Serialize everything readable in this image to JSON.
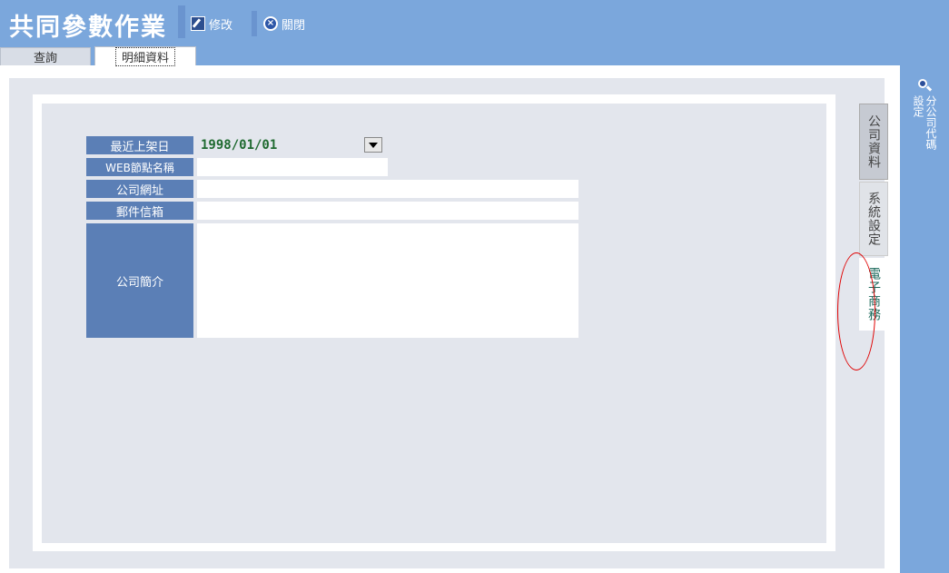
{
  "header": {
    "title": "共同參數作業",
    "edit_label": "修改",
    "close_label": "關閉"
  },
  "top_tabs": [
    {
      "label": "查詢"
    },
    {
      "label": "明細資料"
    }
  ],
  "form": {
    "fields": [
      {
        "label": "最近上架日",
        "value": "1998/01/01"
      },
      {
        "label": "WEB節點名稱",
        "value": ""
      },
      {
        "label": "公司網址",
        "value": ""
      },
      {
        "label": "郵件信箱",
        "value": ""
      },
      {
        "label": "公司簡介",
        "value": ""
      }
    ]
  },
  "side_tabs": [
    {
      "label": "公司資料"
    },
    {
      "label": "系統設定"
    },
    {
      "label": "電子商務"
    }
  ],
  "right_sidebar": {
    "label": "分公司代碼設定"
  },
  "colors": {
    "header_blue": "#7ba7dc",
    "label_blue": "#5b7fb6",
    "panel_gray": "#e3e6ed",
    "date_green": "#1f6a30",
    "annotation_red": "#e00000"
  }
}
